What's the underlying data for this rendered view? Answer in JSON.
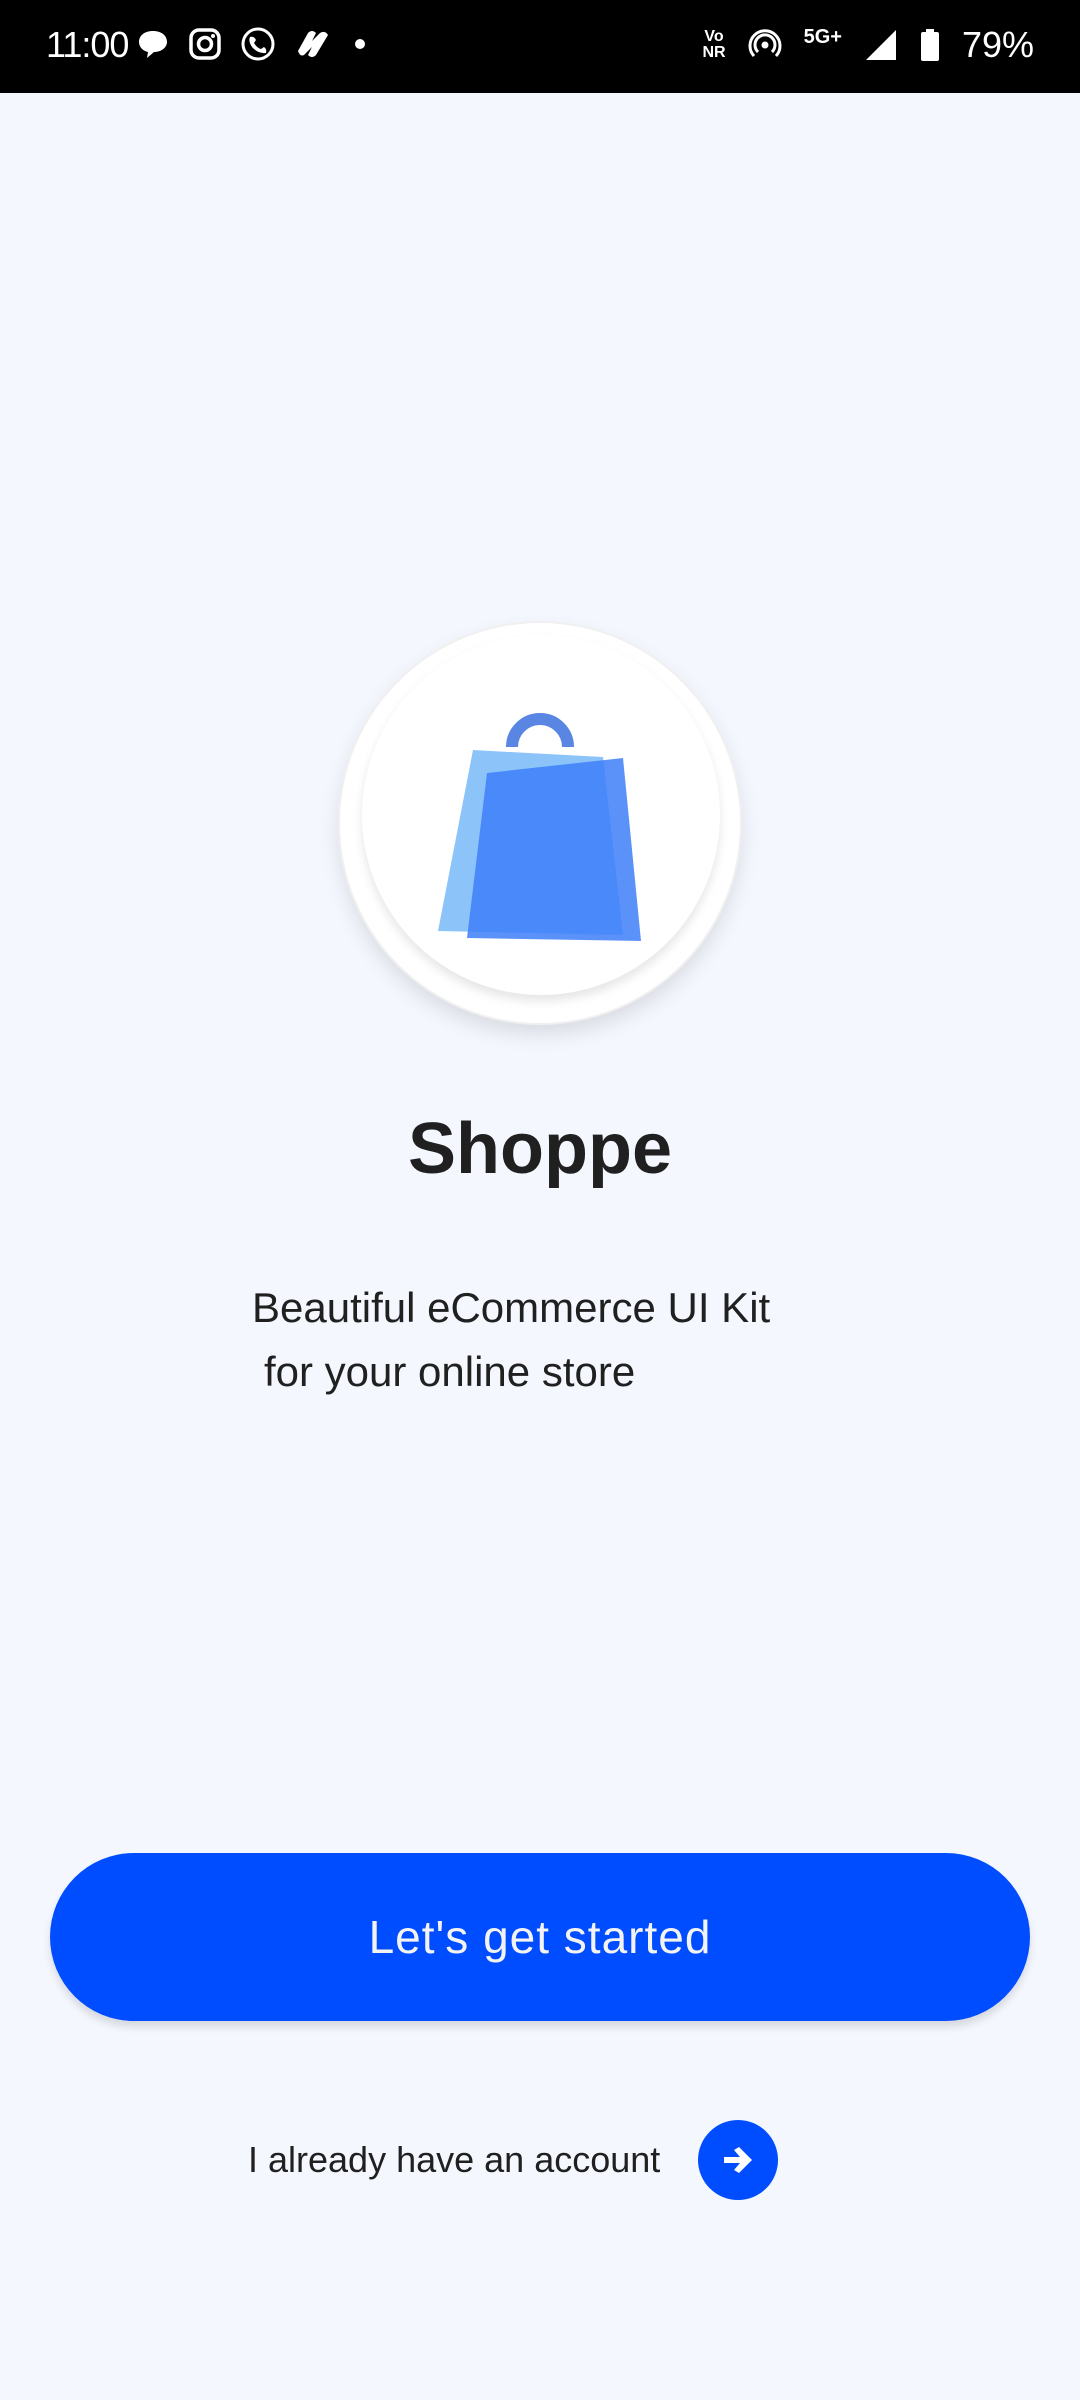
{
  "status_bar": {
    "time": "11:00",
    "volte_top": "Vo",
    "volte_bottom": "NR",
    "network": "5G+",
    "battery": "79%",
    "left_icons": [
      "chat-bubble-icon",
      "instagram-icon",
      "globe-phone-icon",
      "tool-app-icon",
      "dot-icon"
    ],
    "right_icons": [
      "volte-icon",
      "hotspot-icon",
      "signal-icon",
      "battery-icon"
    ]
  },
  "logo": {
    "icon": "shopping-bag-icon",
    "colors": {
      "bag_back": "#8CC4FA",
      "bag_front": "#3D7FF9",
      "handle": "#5A86E3"
    }
  },
  "app": {
    "title": "Shoppe",
    "subtitle_line1": "Beautiful eCommerce UI Kit",
    "subtitle_line2": "for your online store"
  },
  "actions": {
    "get_started_label": "Let's get started",
    "login_label": "I already have an account",
    "login_icon": "arrow-right-icon"
  },
  "colors": {
    "accent": "#004CFF",
    "background": "#F4F7FE",
    "text": "#202020"
  }
}
